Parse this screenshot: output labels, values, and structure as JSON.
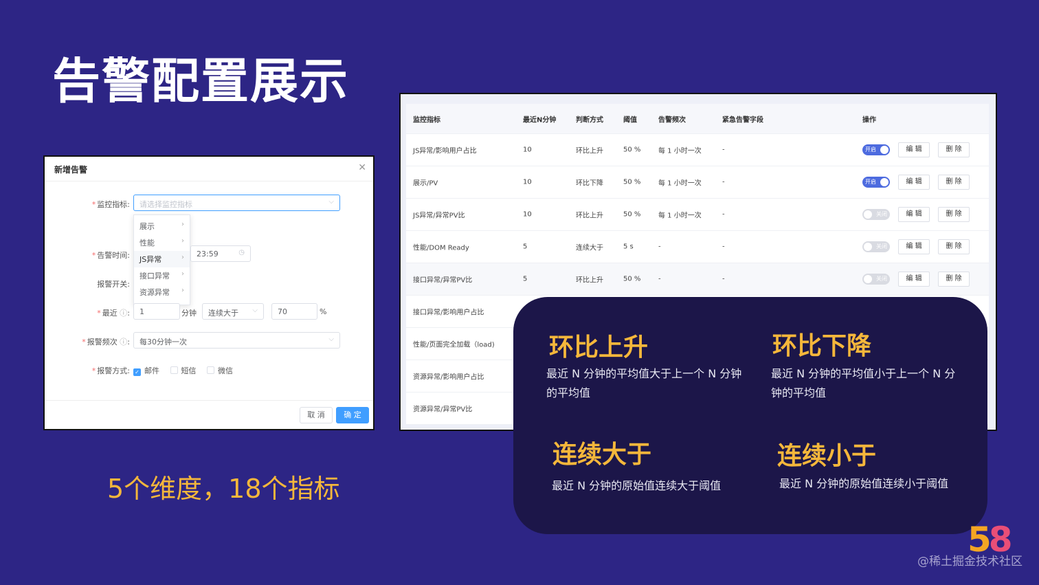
{
  "slide": {
    "title": "告警配置展示",
    "caption": "5个维度，18个指标",
    "watermark": "@稀土掘金技术社区",
    "logo_text": "58"
  },
  "dialog": {
    "title": "新增告警",
    "close_icon": "close-icon",
    "metric_label": "监控指标:",
    "metric_placeholder": "请选择监控指标",
    "dropdown_items": [
      {
        "label": "展示"
      },
      {
        "label": "性能"
      },
      {
        "label": "JS异常"
      },
      {
        "label": "接口异常"
      },
      {
        "label": "资源异常"
      }
    ],
    "time_label": "告警时间:",
    "time_end": "23:59",
    "switch_label": "报警开关:",
    "recent_label": "最近",
    "recent_value": "1",
    "recent_unit": "分钟",
    "judge_value": "连续大于",
    "threshold_value": "70",
    "threshold_unit": "%",
    "freq_label": "报警频次",
    "freq_value": "每30分钟一次",
    "method_label": "报警方式:",
    "methods": [
      {
        "label": "邮件",
        "checked": true
      },
      {
        "label": "短信",
        "checked": false
      },
      {
        "label": "微信",
        "checked": false
      }
    ],
    "cancel_label": "取 消",
    "ok_label": "确 定"
  },
  "table": {
    "headers": [
      "监控指标",
      "最近N分钟",
      "判断方式",
      "阈值",
      "告警频次",
      "紧急告警字段",
      "操作"
    ],
    "rows": [
      {
        "metric": "JS异常/影响用户占比",
        "n": "10",
        "judge": "环比上升",
        "threshold": "50 %",
        "freq": "每 1 小时一次",
        "urgent": "-",
        "toggle": "开启",
        "on": true
      },
      {
        "metric": "展示/PV",
        "n": "10",
        "judge": "环比下降",
        "threshold": "50 %",
        "freq": "每 1 小时一次",
        "urgent": "-",
        "toggle": "开启",
        "on": true
      },
      {
        "metric": "JS异常/异常PV比",
        "n": "10",
        "judge": "环比上升",
        "threshold": "50 %",
        "freq": "每 1 小时一次",
        "urgent": "-",
        "toggle": "关闭",
        "on": false
      },
      {
        "metric": "性能/DOM Ready",
        "n": "5",
        "judge": "连续大于",
        "threshold": "5 s",
        "freq": "-",
        "urgent": "-",
        "toggle": "关闭",
        "on": false
      },
      {
        "metric": "接口异常/异常PV比",
        "n": "5",
        "judge": "环比上升",
        "threshold": "50 %",
        "freq": "-",
        "urgent": "-",
        "toggle": "关闭",
        "on": false
      },
      {
        "metric": "接口异常/影响用户占比"
      },
      {
        "metric": "性能/页面完全加载（load)"
      },
      {
        "metric": "资源异常/影响用户占比"
      },
      {
        "metric": "资源异常/异常PV比"
      }
    ],
    "edit_label": "编 辑",
    "delete_label": "删 除"
  },
  "explain": {
    "items": [
      {
        "title": "环比上升",
        "desc": "最近 N 分钟的平均值大于上一个 N 分钟的平均值"
      },
      {
        "title": "环比下降",
        "desc": "最近 N 分钟的平均值小于上一个 N 分钟的平均值"
      },
      {
        "title": "连续大于",
        "desc": "最近 N 分钟的原始值连续大于阈值"
      },
      {
        "title": "连续小于",
        "desc": "最近 N 分钟的原始值连续小于阈值"
      }
    ]
  }
}
